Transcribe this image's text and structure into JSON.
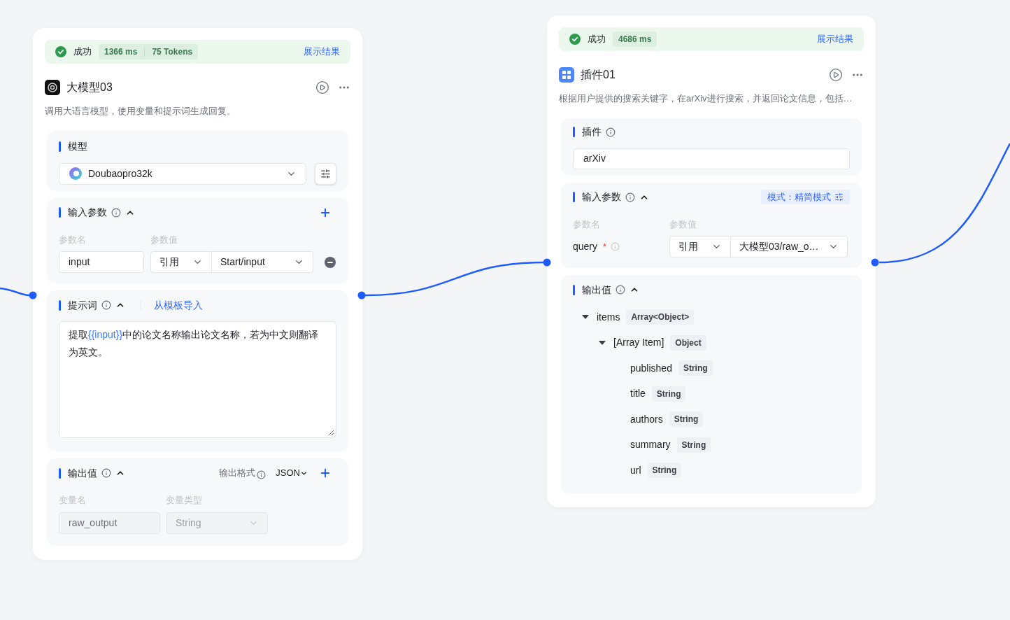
{
  "nodes": [
    {
      "kind": "llm",
      "status": {
        "kind": "success",
        "label": "成功",
        "metrics": [
          "1366 ms",
          "75 Tokens"
        ],
        "link": "展示结果"
      },
      "title": "大模型03",
      "description": "调用大语言模型，使用变量和提示词生成回复。",
      "sections": [
        {
          "kind": "model",
          "label": "模型",
          "value": "Doubaopro32k"
        },
        {
          "kind": "inputs",
          "label": "输入参数",
          "expanded": true,
          "columns": [
            "参数名",
            "参数值"
          ],
          "rows": [
            {
              "name": "input",
              "source": "引用",
              "value": "Start/input"
            }
          ]
        },
        {
          "kind": "prompt",
          "label": "提示词",
          "expanded": true,
          "link": "从模板导入",
          "segments": [
            {
              "kind": "text",
              "text": "提取"
            },
            {
              "kind": "variable",
              "text": "{{input}}"
            },
            {
              "kind": "text",
              "text": "中的论文名称输出论文名称，若为中文则翻译为英文。"
            }
          ]
        },
        {
          "kind": "outputs",
          "label": "输出值",
          "expanded": true,
          "format_label": "输出格式",
          "format": "JSON",
          "columns": [
            "变量名",
            "变量类型"
          ],
          "rows": [
            {
              "name": "raw_output",
              "type": "String",
              "disabled": true
            }
          ]
        }
      ]
    },
    {
      "kind": "plugin",
      "status": {
        "kind": "success",
        "label": "成功",
        "metrics": [
          "4686 ms"
        ],
        "link": "展示结果"
      },
      "title": "插件01",
      "description": "根据用户提供的搜索关键字，在arXiv进行搜索，并返回论文信息，包括…",
      "sections": [
        {
          "kind": "plugin",
          "label": "插件",
          "value": "arXiv"
        },
        {
          "kind": "inputs",
          "label": "输入参数",
          "expanded": true,
          "mode": "模式：精简模式",
          "columns": [
            "参数名",
            "参数值"
          ],
          "rows": [
            {
              "name": "query",
              "required_mark": "*",
              "source": "引用",
              "value": "大模型03/raw_o…"
            }
          ]
        },
        {
          "kind": "output_tree",
          "label": "输出值",
          "expanded": true,
          "tree": [
            {
              "name": "items",
              "type": "Array<Object>",
              "expanded": true,
              "children": [
                {
                  "name": "[Array Item]",
                  "type": "Object",
                  "expanded": true,
                  "children": [
                    {
                      "name": "published",
                      "type": "String"
                    },
                    {
                      "name": "title",
                      "type": "String"
                    },
                    {
                      "name": "authors",
                      "type": "String"
                    },
                    {
                      "name": "summary",
                      "type": "String"
                    },
                    {
                      "name": "url",
                      "type": "String"
                    }
                  ]
                }
              ]
            }
          ]
        }
      ]
    }
  ]
}
